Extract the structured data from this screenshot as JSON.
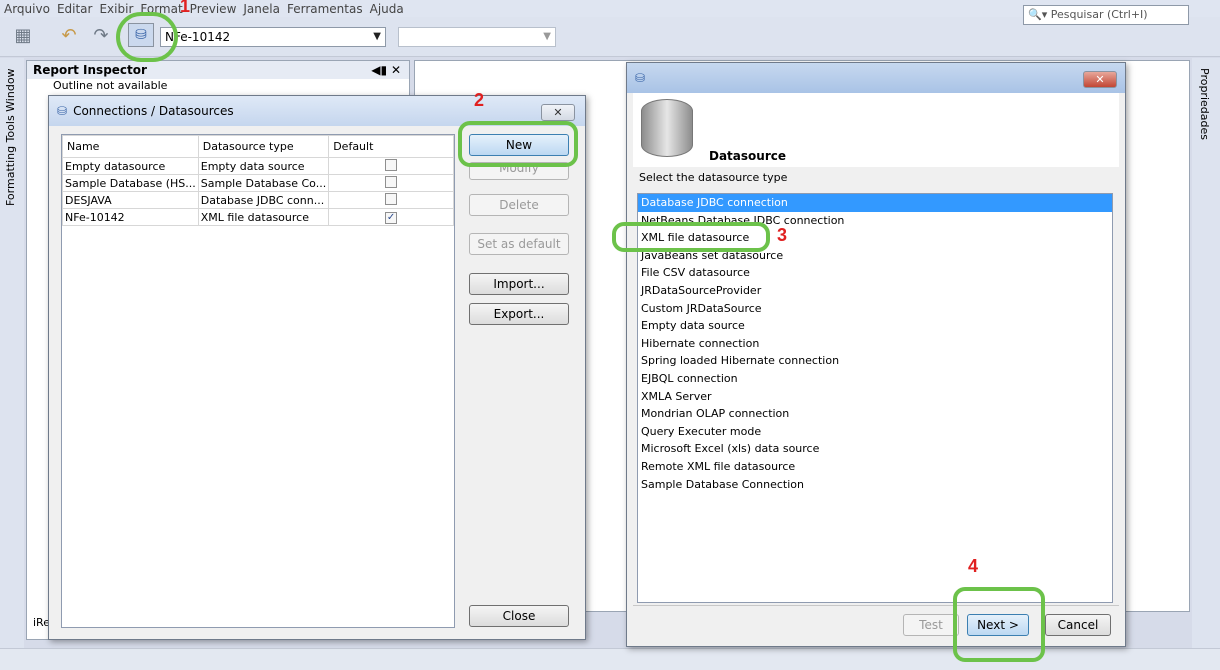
{
  "menu": [
    "Arquivo",
    "Editar",
    "Exibir",
    "Format",
    "Preview",
    "Janela",
    "Ferramentas",
    "Ajuda"
  ],
  "toolbar": {
    "datasource_combo": "NFe-10142",
    "search_placeholder": "Pesquisar (Ctrl+I)"
  },
  "side": {
    "left_tab": "Formatting Tools Window",
    "right_tab": "Propriedades"
  },
  "inspector": {
    "title": "Report Inspector",
    "outline": "Outline not available",
    "status_partial": "iRe"
  },
  "connections": {
    "title": "Connections / Datasources",
    "columns": [
      "Name",
      "Datasource type",
      "Default"
    ],
    "rows": [
      {
        "name": "Empty datasource",
        "type": "Empty data source",
        "default": ""
      },
      {
        "name": "Sample Database (HS...",
        "type": "Sample Database Co...",
        "default": ""
      },
      {
        "name": "DESJAVA",
        "type": "Database JDBC conn...",
        "default": ""
      },
      {
        "name": "NFe-10142",
        "type": "XML file datasource",
        "default": "✓"
      }
    ],
    "buttons": {
      "new": "New",
      "modify": "Modify",
      "delete": "Delete",
      "set_default": "Set as default",
      "import": "Import...",
      "export": "Export...",
      "close": "Close"
    }
  },
  "datasource": {
    "heading": "Datasource",
    "prompt": "Select the datasource type",
    "types": [
      "Database JDBC connection",
      "NetBeans Database JDBC connection",
      "XML file datasource",
      "JavaBeans set datasource",
      "File CSV datasource",
      "JRDataSourceProvider",
      "Custom JRDataSource",
      "Empty data source",
      "Hibernate connection",
      "Spring loaded Hibernate connection",
      "EJBQL connection",
      "XMLA Server",
      "Mondrian OLAP connection",
      "Query Executer mode",
      "Microsoft Excel (xls) data source",
      "Remote XML file datasource",
      "Sample Database Connection"
    ],
    "buttons": {
      "test": "Test",
      "next": "Next >",
      "cancel": "Cancel"
    }
  },
  "annotations": {
    "n1": "1",
    "n2": "2",
    "n3": "3",
    "n4": "4"
  },
  "colors": {
    "highlight_ring": "#6cc24a",
    "annotation": "#e02020",
    "selection": "#3399ff"
  }
}
